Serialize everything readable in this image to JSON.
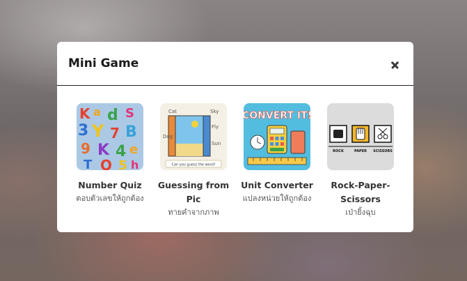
{
  "modal": {
    "title": "Mini Game"
  },
  "games": [
    {
      "title": "Number Quiz",
      "subtitle": "ตอบตัวเลขให้ถูกต้อง",
      "icon": "colorful-letters-numbers-icon"
    },
    {
      "title": "Guessing from Pic",
      "subtitle": "ทายคำจากภาพ",
      "icon": "picture-window-icon",
      "thumb_caption": "Can you guess the word?"
    },
    {
      "title": "Unit Converter",
      "subtitle": "แปลงหน่วยให้ถูกต้อง",
      "icon": "calculator-ruler-icon",
      "thumb_caption": "CONVERT IT!"
    },
    {
      "title": "Rock-Paper-Scissors",
      "subtitle": "เป่ายิ้งฉุบ",
      "icon": "rock-paper-scissors-hands-icon",
      "thumb_caption": [
        "ROCK",
        "PAPER",
        "SCISSORS"
      ]
    }
  ],
  "colors": {
    "accent": "#222222",
    "thumb_quiz": "#8fb6d9",
    "thumb_convert": "#53bde0",
    "thumb_rps": "#dcdcdc"
  }
}
